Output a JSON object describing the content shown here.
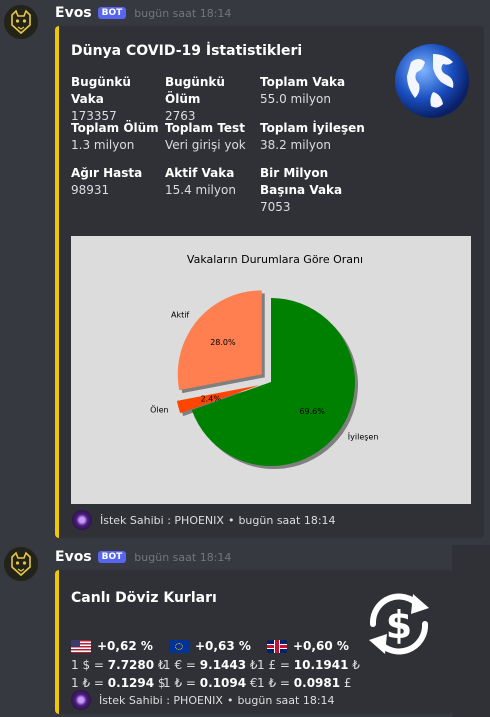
{
  "messages": [
    {
      "author": "Evos",
      "bot_tag": "BOT",
      "timestamp": "bugün saat 18:14",
      "embed": {
        "title": "Dünya COVID-19 İstatistikleri",
        "fields": [
          {
            "name": "Bugünkü Vaka",
            "value": "173357"
          },
          {
            "name": "Bugünkü Ölüm",
            "value": "2763"
          },
          {
            "name": "Toplam Vaka",
            "value": "55.0 milyon"
          },
          {
            "name": "Toplam Ölüm",
            "value": "1.3 milyon"
          },
          {
            "name": "Toplam Test",
            "value": "Veri girişi yok"
          },
          {
            "name": "Toplam İyileşen",
            "value": "38.2 milyon"
          },
          {
            "name": "Ağır Hasta",
            "value": "98931"
          },
          {
            "name": "Aktif Vaka",
            "value": "15.4 milyon"
          },
          {
            "name": "Bir Milyon Başına Vaka",
            "value": "7053"
          }
        ],
        "footer": {
          "text": "İstek Sahibi : PHOENIX",
          "timestamp": "bugün saat 18:14"
        },
        "thumbnail_icon": "globe-icon"
      }
    },
    {
      "author": "Evos",
      "bot_tag": "BOT",
      "timestamp": "bugün saat 18:14",
      "embed": {
        "title": "Canlı Döviz Kurları",
        "rates": [
          {
            "flag": "us-flag-icon",
            "change": "+0,62 %",
            "line1_pre": "1 $ = ",
            "line1_val": "7.7280",
            "line1_unit": " ₺",
            "line2_pre": "1 ₺ = ",
            "line2_val": "0.1294",
            "line2_unit": " $"
          },
          {
            "flag": "eu-flag-icon",
            "change": "+0,63 %",
            "line1_pre": "1 € = ",
            "line1_val": "9.1443",
            "line1_unit": " ₺",
            "line2_pre": "1 ₺ = ",
            "line2_val": "0.1094",
            "line2_unit": " €"
          },
          {
            "flag": "uk-flag-icon",
            "change": "+0,60 %",
            "line1_pre": "1 £ = ",
            "line1_val": "10.1941",
            "line1_unit": " ₺",
            "line2_pre": "1 ₺ = ",
            "line2_val": "0.0981",
            "line2_unit": " £"
          }
        ],
        "footer": {
          "text": "İstek Sahibi : PHOENIX",
          "timestamp": "bugün saat 18:14"
        },
        "thumbnail_icon": "currency-exchange-icon"
      }
    }
  ],
  "colors": {
    "embed_border": "#f0c800",
    "bot_tag": "#5865f2",
    "background": "#36393f",
    "embed_bg": "#2f3136"
  },
  "chart_data": {
    "type": "pie",
    "title": "Vakaların Durumlara Göre Oranı",
    "labels": [
      "Aktif",
      "Ölen",
      "İyileşen"
    ],
    "values": [
      28.0,
      2.4,
      69.6
    ],
    "value_labels": [
      "28.0%",
      "2.4%",
      "69.6%"
    ],
    "colors": [
      "#ff7f50",
      "#ff4500",
      "#008000"
    ],
    "exploded": [
      true,
      true,
      false
    ]
  }
}
